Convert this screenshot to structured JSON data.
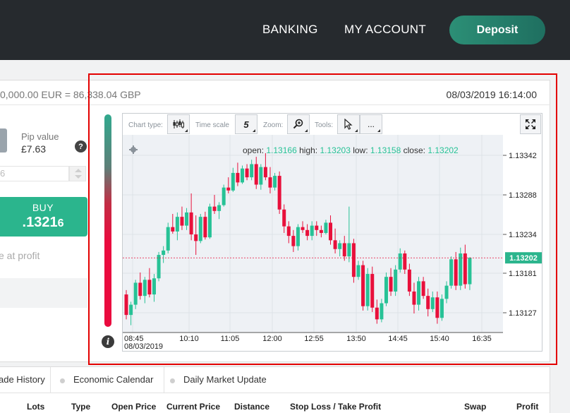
{
  "header": {
    "nav": [
      "BANKING",
      "MY ACCOUNT"
    ],
    "deposit_label": "Deposit"
  },
  "trade": {
    "conversion": "0,000.00 EUR = 86,338.04 GBP",
    "datetime": "08/03/2019 16:14:00",
    "pip_label": "Pip value",
    "pip_value": "£7.63",
    "help": "?",
    "amount_value": "6",
    "buy_label": "BUY",
    "buy_price_main": ".1321",
    "buy_price_small": "6",
    "close_profit": "e at profit"
  },
  "chart": {
    "toolbar": {
      "chart_type_label": "Chart type:",
      "time_scale_label": "Time scale",
      "time_scale_value": "5",
      "zoom_label": "Zoom:",
      "tools_label": "Tools:",
      "more_label": "..."
    },
    "ohlc": {
      "open_label": "open:",
      "open": "1.13166",
      "high_label": "high:",
      "high": "1.13203",
      "low_label": "low:",
      "low": "1.13158",
      "close_label": "close:",
      "close": "1.13202"
    },
    "info": "i",
    "colors": {
      "up": "#27c296",
      "down": "#e8103b",
      "current_price": "#2bb58d"
    }
  },
  "chart_data": {
    "type": "candlestick",
    "x_ticks": [
      "08:45",
      "10:10",
      "11:05",
      "12:00",
      "12:55",
      "13:50",
      "14:45",
      "15:40",
      "16:35"
    ],
    "x_start_date": "08/03/2019",
    "y_ticks": [
      1.13342,
      1.13288,
      1.13234,
      1.13181,
      1.13127
    ],
    "current_price": 1.13202,
    "ylim": [
      1.131,
      1.1337
    ],
    "candles": [
      [
        1.13152,
        1.13158,
        1.13118,
        1.13124
      ],
      [
        1.13124,
        1.13142,
        1.1311,
        1.13138
      ],
      [
        1.13138,
        1.13172,
        1.13132,
        1.13168
      ],
      [
        1.13168,
        1.13182,
        1.13145,
        1.1315
      ],
      [
        1.1315,
        1.13176,
        1.1314,
        1.13172
      ],
      [
        1.13172,
        1.13188,
        1.13148,
        1.13152
      ],
      [
        1.13152,
        1.1318,
        1.13142,
        1.13174
      ],
      [
        1.13174,
        1.1321,
        1.1317,
        1.13206
      ],
      [
        1.13206,
        1.13218,
        1.13195,
        1.13212
      ],
      [
        1.13212,
        1.1325,
        1.13208,
        1.13244
      ],
      [
        1.13244,
        1.13262,
        1.13235,
        1.13238
      ],
      [
        1.13238,
        1.13264,
        1.13226,
        1.13258
      ],
      [
        1.13258,
        1.13272,
        1.1324,
        1.13246
      ],
      [
        1.13246,
        1.1327,
        1.1324,
        1.13264
      ],
      [
        1.13264,
        1.1329,
        1.13226,
        1.13234
      ],
      [
        1.13234,
        1.1326,
        1.13206,
        1.13225
      ],
      [
        1.13225,
        1.13262,
        1.13222,
        1.13258
      ],
      [
        1.13258,
        1.13265,
        1.13227,
        1.1323
      ],
      [
        1.1323,
        1.13276,
        1.13228,
        1.13272
      ],
      [
        1.13272,
        1.13288,
        1.13262,
        1.13266
      ],
      [
        1.13266,
        1.13278,
        1.13255,
        1.13274
      ],
      [
        1.13274,
        1.13302,
        1.13272,
        1.13298
      ],
      [
        1.13298,
        1.13312,
        1.1329,
        1.13294
      ],
      [
        1.13294,
        1.13325,
        1.13292,
        1.13318
      ],
      [
        1.13318,
        1.13332,
        1.133,
        1.13305
      ],
      [
        1.13305,
        1.13328,
        1.13303,
        1.13324
      ],
      [
        1.13324,
        1.1333,
        1.13308,
        1.13312
      ],
      [
        1.13312,
        1.13336,
        1.13308,
        1.1333
      ],
      [
        1.1333,
        1.1334,
        1.13296,
        1.13302
      ],
      [
        1.13302,
        1.1333,
        1.13295,
        1.13326
      ],
      [
        1.13326,
        1.13345,
        1.13308,
        1.13312
      ],
      [
        1.13312,
        1.13326,
        1.1329,
        1.13298
      ],
      [
        1.13298,
        1.13318,
        1.13294,
        1.13314
      ],
      [
        1.13314,
        1.1332,
        1.13262,
        1.13268
      ],
      [
        1.13268,
        1.13275,
        1.13236,
        1.13245
      ],
      [
        1.13245,
        1.13252,
        1.13222,
        1.13232
      ],
      [
        1.13232,
        1.1324,
        1.1321,
        1.13218
      ],
      [
        1.13218,
        1.13248,
        1.13212,
        1.13244
      ],
      [
        1.13244,
        1.13252,
        1.13236,
        1.1324
      ],
      [
        1.1324,
        1.13248,
        1.13226,
        1.13232
      ],
      [
        1.13232,
        1.13252,
        1.13226,
        1.13246
      ],
      [
        1.13246,
        1.13252,
        1.13232,
        1.1324
      ],
      [
        1.1324,
        1.13246,
        1.1323,
        1.13236
      ],
      [
        1.13236,
        1.13254,
        1.13234,
        1.1325
      ],
      [
        1.1325,
        1.1326,
        1.1322,
        1.13226
      ],
      [
        1.13226,
        1.13242,
        1.13208,
        1.13214
      ],
      [
        1.13214,
        1.13226,
        1.13204,
        1.13222
      ],
      [
        1.13222,
        1.13232,
        1.13198,
        1.13204
      ],
      [
        1.13204,
        1.13272,
        1.13196,
        1.13222
      ],
      [
        1.13222,
        1.13228,
        1.13168,
        1.13176
      ],
      [
        1.13176,
        1.13198,
        1.13172,
        1.13192
      ],
      [
        1.13192,
        1.13198,
        1.1313,
        1.13136
      ],
      [
        1.13136,
        1.13188,
        1.1313,
        1.1318
      ],
      [
        1.1318,
        1.1319,
        1.13128,
        1.13134
      ],
      [
        1.13134,
        1.13145,
        1.13112,
        1.13118
      ],
      [
        1.13118,
        1.13146,
        1.13114,
        1.1314
      ],
      [
        1.1314,
        1.13182,
        1.13136,
        1.13176
      ],
      [
        1.13176,
        1.13188,
        1.1315,
        1.13156
      ],
      [
        1.13156,
        1.13192,
        1.1315,
        1.13186
      ],
      [
        1.13186,
        1.13215,
        1.13182,
        1.13208
      ],
      [
        1.13208,
        1.13212,
        1.1318,
        1.13186
      ],
      [
        1.13186,
        1.13194,
        1.1315,
        1.13156
      ],
      [
        1.13156,
        1.13168,
        1.13126,
        1.13138
      ],
      [
        1.13138,
        1.13176,
        1.1313,
        1.1317
      ],
      [
        1.1317,
        1.13176,
        1.13146,
        1.1315
      ],
      [
        1.1315,
        1.1316,
        1.13122,
        1.13132
      ],
      [
        1.13132,
        1.13156,
        1.13128,
        1.13148
      ],
      [
        1.13148,
        1.13156,
        1.13112,
        1.1312
      ],
      [
        1.1312,
        1.13152,
        1.13116,
        1.13146
      ],
      [
        1.13146,
        1.1317,
        1.1314,
        1.13164
      ],
      [
        1.13164,
        1.13204,
        1.1316,
        1.132
      ],
      [
        1.132,
        1.1321,
        1.13158,
        1.13164
      ],
      [
        1.13164,
        1.13216,
        1.13158,
        1.13208
      ],
      [
        1.13208,
        1.1322,
        1.1316,
        1.13166
      ],
      [
        1.13166,
        1.13203,
        1.13158,
        1.13202
      ]
    ]
  },
  "bottom": {
    "tabs": [
      "ade History",
      "Economic Calendar",
      "Daily Market Update"
    ],
    "columns": [
      "Lots",
      "Type",
      "Open Price",
      "Current Price",
      "Distance",
      "Stop Loss / Take Profit",
      "Swap",
      "Profit"
    ]
  }
}
